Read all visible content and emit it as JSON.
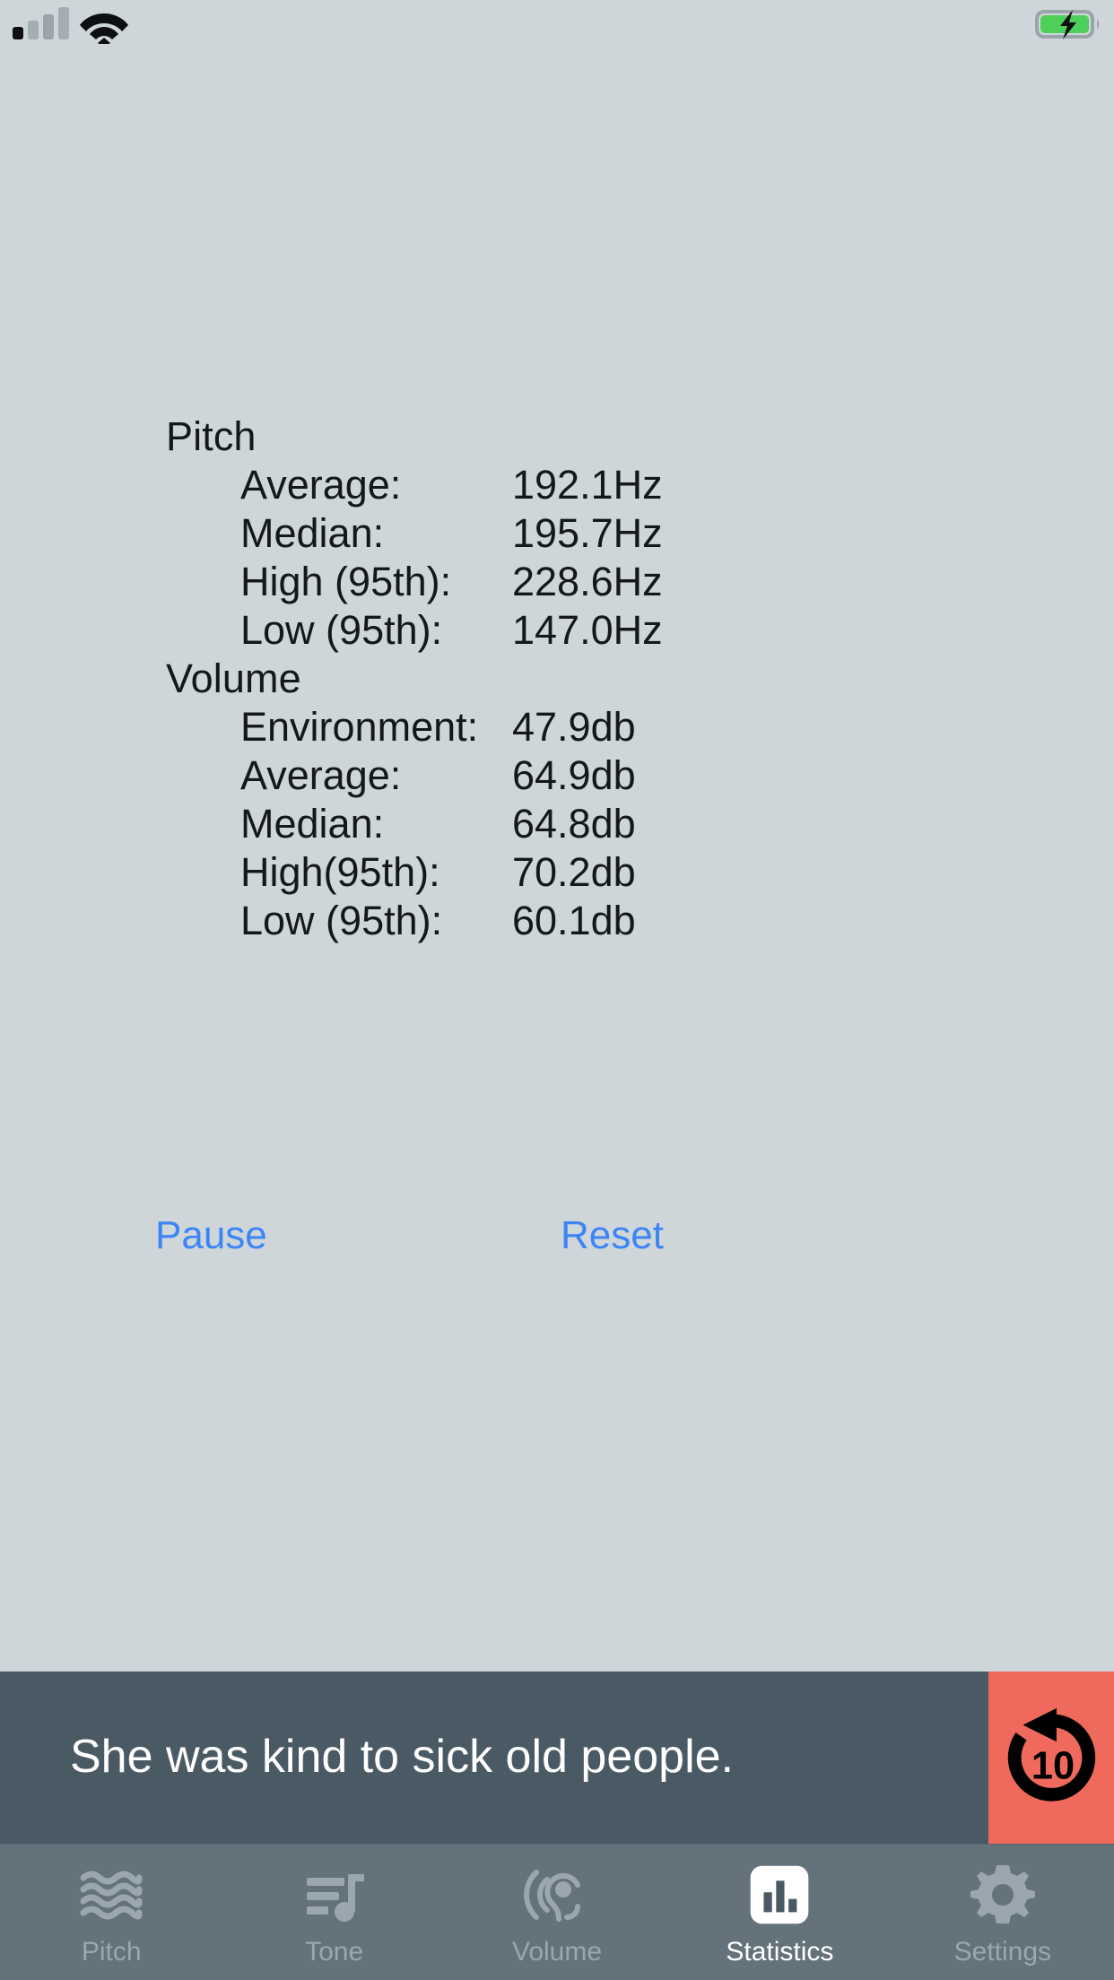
{
  "status_bar": {
    "signal_icon": "cellular-signal-icon",
    "signal_bars_active": 1,
    "signal_bars_total": 4,
    "wifi_icon": "wifi-icon",
    "battery_icon": "battery-charging-icon",
    "battery_color": "#4cd05a"
  },
  "stats": {
    "groups": [
      {
        "title": "Pitch",
        "rows": [
          {
            "label": "Average:",
            "value": "192.1Hz"
          },
          {
            "label": "Median:",
            "value": "195.7Hz"
          },
          {
            "label": "High (95th):",
            "value": "228.6Hz"
          },
          {
            "label": "Low (95th):",
            "value": "147.0Hz"
          }
        ]
      },
      {
        "title": "Volume",
        "rows": [
          {
            "label": "Environment:",
            "value": "47.9db"
          },
          {
            "label": "Average:",
            "value": "64.9db"
          },
          {
            "label": "Median:",
            "value": "64.8db"
          },
          {
            "label": "High(95th):",
            "value": "70.2db"
          },
          {
            "label": "Low (95th):",
            "value": "60.1db"
          }
        ]
      }
    ]
  },
  "actions": {
    "pause_label": "Pause",
    "reset_label": "Reset",
    "link_color": "#3d85f4"
  },
  "banner": {
    "sentence": "She was kind to sick old people.",
    "background_color": "#4a5a64",
    "replay_icon": "replay-10-icon",
    "replay_seconds": "10",
    "replay_background_color": "#ef6a5c"
  },
  "tab_bar": {
    "background_color": "#63727b",
    "active_tab": "Statistics",
    "tabs": [
      {
        "label": "Pitch",
        "icon": "waves-icon",
        "active": false
      },
      {
        "label": "Tone",
        "icon": "music-note-icon",
        "active": false
      },
      {
        "label": "Volume",
        "icon": "ear-hearing-icon",
        "active": false
      },
      {
        "label": "Statistics",
        "icon": "bar-chart-icon",
        "active": true
      },
      {
        "label": "Settings",
        "icon": "gear-icon",
        "active": false
      }
    ]
  }
}
